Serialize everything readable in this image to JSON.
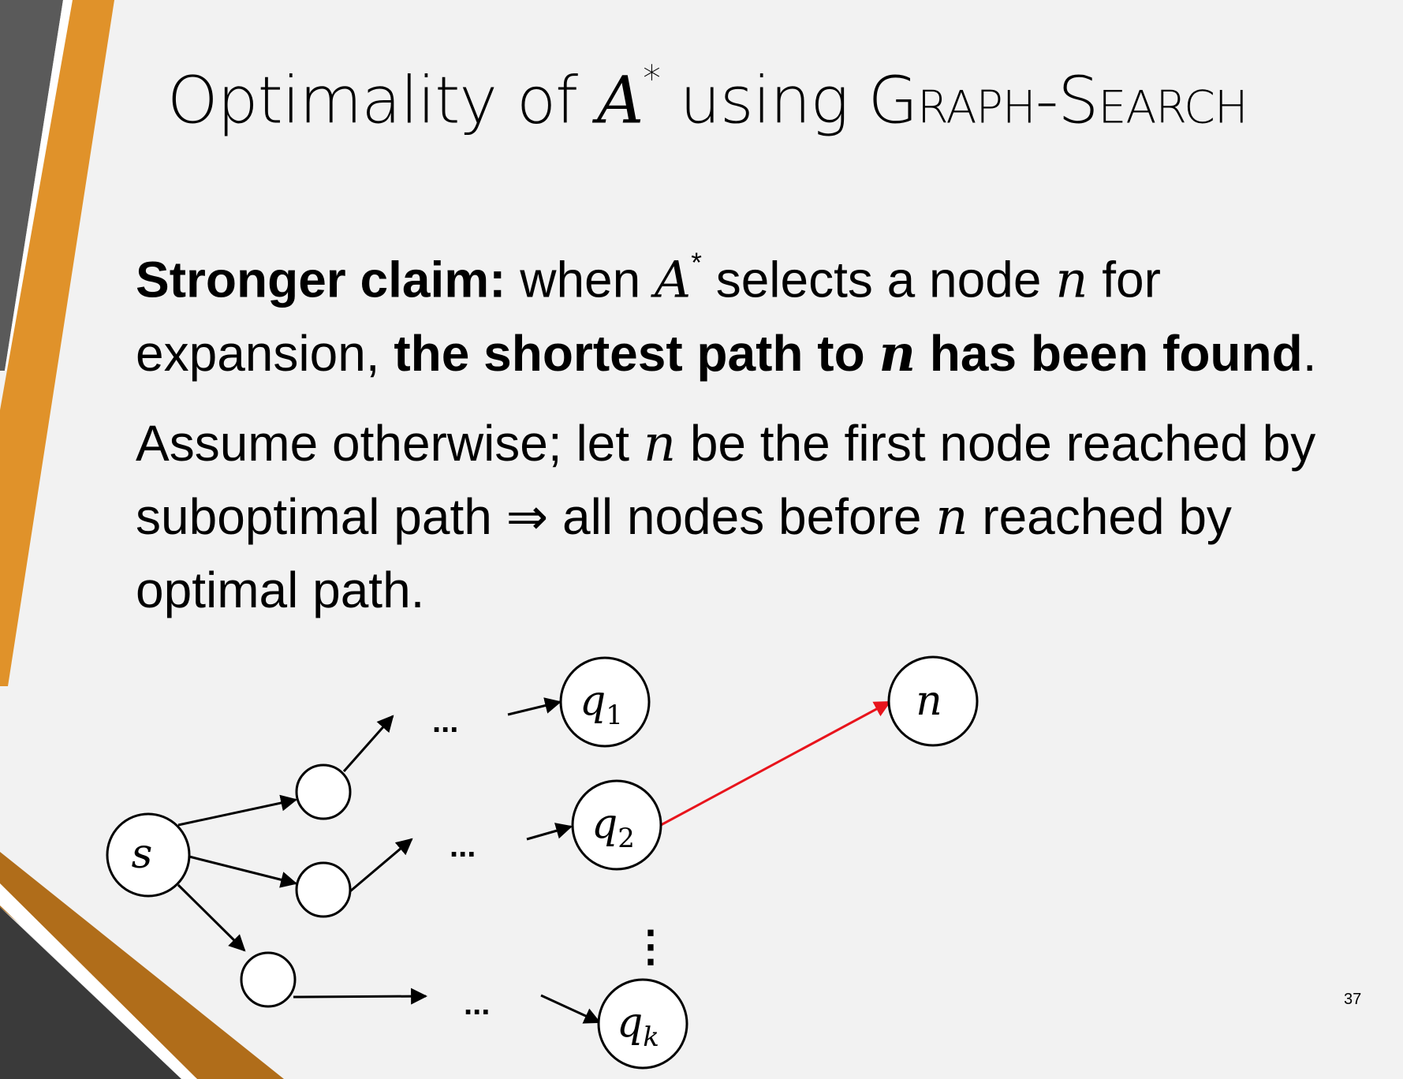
{
  "title": {
    "prefix": "Optimality of ",
    "math": "A",
    "sup": "*",
    "middle": " using ",
    "algorithm": "Graph-Search"
  },
  "claim": {
    "label": "Stronger claim:",
    "text1": " when ",
    "math_a": "A",
    "sup": "*",
    "text2": " selects a node ",
    "math_n": "n",
    "text3": " for",
    "line2_start": "expansion, ",
    "bold_part1": "the shortest path to ",
    "bold_n": "n",
    "bold_part2": " has been found",
    "end": "."
  },
  "assumption": {
    "line1_a": "Assume otherwise; let ",
    "line1_n": "n",
    "line1_b": " be the first node reached by",
    "line2_a": "suboptimal path ⇒ all nodes before ",
    "line2_n": "n",
    "line2_b": " reached by",
    "line3": "optimal path."
  },
  "diagram": {
    "start_node": "s",
    "target_node": "n",
    "q_nodes": [
      {
        "base": "q",
        "sub": "1"
      },
      {
        "base": "q",
        "sub": "2"
      },
      {
        "base": "q",
        "sub": "k"
      }
    ],
    "ellipsis": "...",
    "vertical_ellipsis": "⋮",
    "highlight_color": "#e8141c"
  },
  "page_number": "37",
  "colors": {
    "background": "#f2f2f2",
    "accent_orange": "#e0922a",
    "accent_dark_orange": "#b06d1a",
    "accent_gray": "#5a5a5a",
    "accent_dark": "#3a3a3a"
  }
}
